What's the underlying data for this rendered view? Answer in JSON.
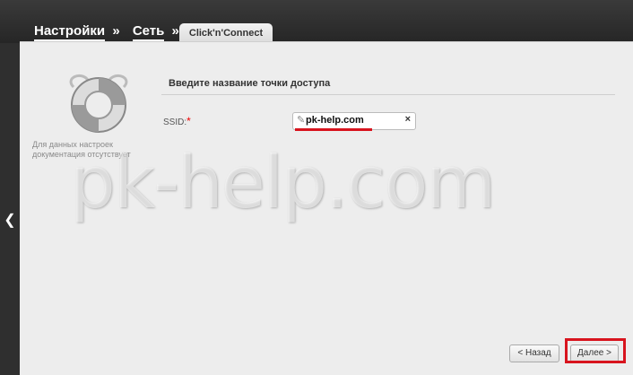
{
  "header": {
    "crumbs": [
      "Настройки",
      "Сеть"
    ],
    "separator": "»",
    "active_tab": "Click'n'Connect"
  },
  "side": {
    "note": "Для данных настроек документация отсутствует"
  },
  "form": {
    "section_title": "Введите название точки доступа",
    "ssid_label": "SSID:",
    "required_mark": "*",
    "ssid_value": "pk-help.com",
    "clear_glyph": "×"
  },
  "watermark": "pk-help.com",
  "buttons": {
    "back": "< Назад",
    "next": "Далее >"
  },
  "colors": {
    "highlight": "#d8141e"
  }
}
